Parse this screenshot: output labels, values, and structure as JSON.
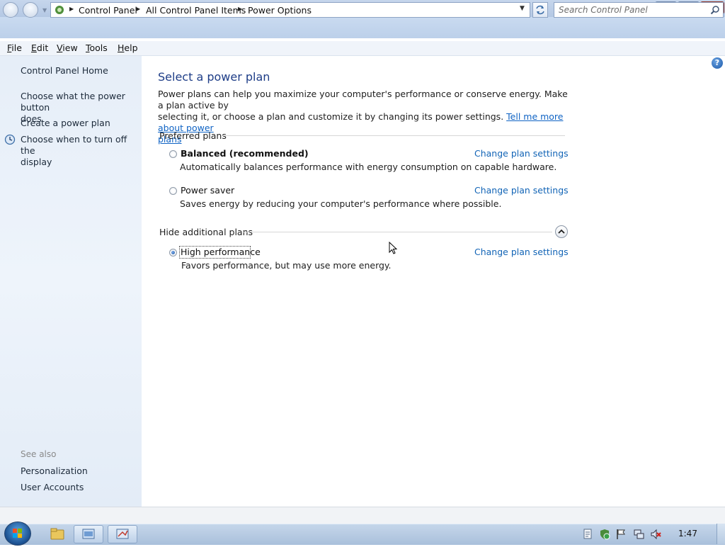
{
  "window": {
    "icons": {
      "minimize": "minimize-icon",
      "maximize": "restore-icon",
      "close": "close-icon"
    }
  },
  "address": {
    "breadcrumb": [
      "Control Panel",
      "All Control Panel Items",
      "Power Options"
    ],
    "search_placeholder": "Search Control Panel"
  },
  "menu": {
    "items": [
      {
        "label": "File",
        "key": "F",
        "rest": "ile"
      },
      {
        "label": "Edit",
        "key": "E",
        "rest": "dit"
      },
      {
        "label": "View",
        "key": "V",
        "rest": "iew"
      },
      {
        "label": "Tools",
        "key": "T",
        "rest": "ools"
      },
      {
        "label": "Help",
        "key": "H",
        "rest": "elp"
      }
    ]
  },
  "sidebar": {
    "home": "Control Panel Home",
    "links": [
      {
        "label_line1": "Choose what the power button",
        "label_line2": "does"
      },
      {
        "label_line1": "Create a power plan",
        "label_line2": ""
      },
      {
        "label_line1": "Choose when to turn off the",
        "label_line2": "display"
      }
    ],
    "see_also_title": "See also",
    "see_also": [
      "Personalization",
      "User Accounts"
    ]
  },
  "main": {
    "title": "Select a power plan",
    "intro_line1": "Power plans can help you maximize your computer's performance or conserve energy. Make a plan active by",
    "intro_line2_text": "selecting it, or choose a plan and customize it by changing its power settings. ",
    "intro_link_part1": "Tell me more about power",
    "intro_link_part2": "plans",
    "preferred_heading": "Preferred plans",
    "additional_heading": "Hide additional plans",
    "change_link": "Change plan settings",
    "plans": [
      {
        "name": "Balanced (recommended)",
        "description": "Automatically balances performance with energy consumption on capable hardware.",
        "selected": false
      },
      {
        "name": "Power saver",
        "description": "Saves energy by reducing your computer's performance where possible.",
        "selected": false
      },
      {
        "name": "High performance",
        "description": "Favors performance, but may use more energy.",
        "selected": true
      }
    ]
  },
  "taskbar": {
    "clock": "1:47"
  },
  "colors": {
    "title_blue": "#1e3d87",
    "link_blue": "#1264b6",
    "sidebar_bg": "#e6eef8"
  }
}
